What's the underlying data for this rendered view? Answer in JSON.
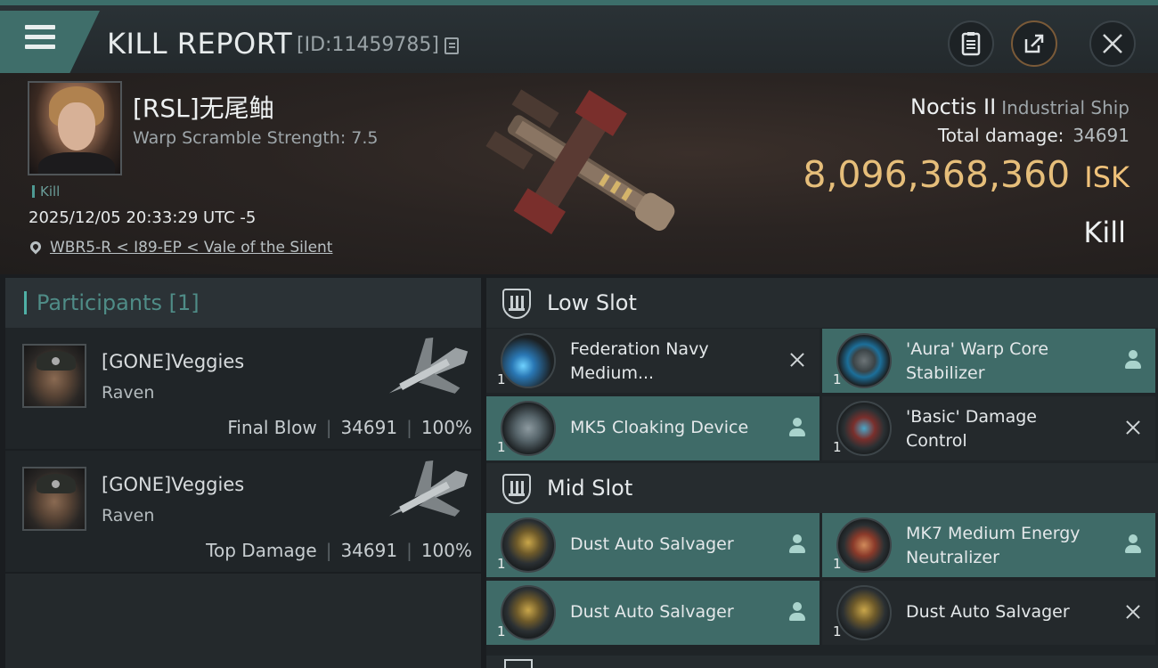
{
  "header": {
    "title": "KILL REPORT",
    "report_id": "[ID:11459785]",
    "icons": [
      "menu-icon",
      "copy-icon",
      "clipboard-icon",
      "share-icon",
      "close-icon"
    ]
  },
  "victim": {
    "name": "[RSL]无尾鲉",
    "warp_scramble": "Warp Scramble Strength: 7.5",
    "kill_tag": "Kill",
    "datetime": "2025/12/05 20:33:29 UTC -5",
    "location": "WBR5-R < I89-EP < Vale of the Silent"
  },
  "ship": {
    "name": "Noctis II",
    "class": "Industrial Ship",
    "total_damage_label": "Total damage:",
    "total_damage": "34691",
    "isk_value": "8,096,368,360",
    "isk_unit": "ISK",
    "result": "Kill"
  },
  "participants": {
    "title": "Participants [1]",
    "rows": [
      {
        "name": "[GONE]Veggies",
        "ship": "Raven",
        "role": "Final Blow",
        "damage": "34691",
        "percent": "100%"
      },
      {
        "name": "[GONE]Veggies",
        "ship": "Raven",
        "role": "Top Damage",
        "damage": "34691",
        "percent": "100%"
      }
    ]
  },
  "fitting": {
    "low_slot": {
      "label": "Low Slot",
      "modules": [
        {
          "line1": "Federation Navy",
          "line2": "Medium...",
          "qty": "1",
          "status": "destroyed",
          "highlight": false,
          "icon": "plasma-cell-icon"
        },
        {
          "line1": "'Aura' Warp Core",
          "line2": "Stabilizer",
          "qty": "1",
          "status": "dropped",
          "highlight": true,
          "icon": "warp-core-icon"
        },
        {
          "line1": "MK5 Cloaking Device",
          "line2": "",
          "qty": "1",
          "status": "dropped",
          "highlight": true,
          "icon": "cloak-icon"
        },
        {
          "line1": "'Basic' Damage",
          "line2": "Control",
          "qty": "1",
          "status": "destroyed",
          "highlight": false,
          "icon": "damage-control-icon"
        }
      ]
    },
    "mid_slot": {
      "label": "Mid Slot",
      "modules": [
        {
          "line1": "Dust Auto Salvager",
          "line2": "",
          "qty": "1",
          "status": "dropped",
          "highlight": true,
          "icon": "salvager-icon"
        },
        {
          "line1": "MK7 Medium Energy",
          "line2": "Neutralizer",
          "qty": "1",
          "status": "dropped",
          "highlight": true,
          "icon": "neutralizer-icon"
        },
        {
          "line1": "Dust Auto Salvager",
          "line2": "",
          "qty": "1",
          "status": "dropped",
          "highlight": true,
          "icon": "salvager-icon"
        },
        {
          "line1": "Dust Auto Salvager",
          "line2": "",
          "qty": "1",
          "status": "destroyed",
          "highlight": false,
          "icon": "salvager-icon"
        }
      ]
    }
  },
  "colors": {
    "accent": "#3f6b68",
    "isk": "#e6be7a",
    "participant_title": "#4f8c87"
  }
}
